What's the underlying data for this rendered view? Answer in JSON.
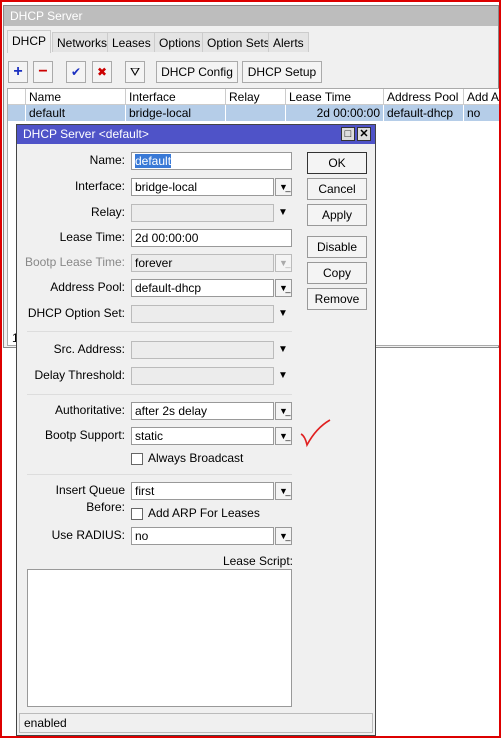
{
  "window": {
    "title": "DHCP Server",
    "tabs": [
      "DHCP",
      "Networks",
      "Leases",
      "Options",
      "Option Sets",
      "Alerts"
    ],
    "toolbar": {
      "add": "+",
      "remove": "−",
      "enable": "✔",
      "disable": "✖",
      "filter": "⛛",
      "dhcp_config": "DHCP Config",
      "dhcp_setup": "DHCP Setup"
    },
    "columns": [
      "Name",
      "Interface",
      "Relay",
      "Lease Time",
      "Address Pool",
      "Add AR"
    ],
    "rows": [
      [
        "default",
        "bridge-local",
        "",
        "2d 00:00:00",
        "default-dhcp",
        "no"
      ]
    ],
    "count_partial": "1"
  },
  "dialog": {
    "title": "DHCP Server <default>",
    "fields": [
      {
        "label": "Name:",
        "value": "default",
        "type": "text"
      },
      {
        "label": "Interface:",
        "value": "bridge-local",
        "type": "combo"
      },
      {
        "label": "Relay:",
        "value": "",
        "type": "opt"
      },
      {
        "label": "Lease Time:",
        "value": "2d 00:00:00",
        "type": "text"
      },
      {
        "label": "Bootp Lease Time:",
        "value": "forever",
        "type": "combo",
        "disabled": true
      },
      {
        "label": "Address Pool:",
        "value": "default-dhcp",
        "type": "combo"
      },
      {
        "label": "DHCP Option Set:",
        "value": "",
        "type": "opt"
      },
      {
        "label": "Src. Address:",
        "value": "",
        "type": "opt"
      },
      {
        "label": "Delay Threshold:",
        "value": "",
        "type": "opt"
      },
      {
        "label": "Authoritative:",
        "value": "after 2s delay",
        "type": "combo"
      },
      {
        "label": "Bootp Support:",
        "value": "static",
        "type": "combo"
      },
      {
        "label": "Always Broadcast",
        "checked": false,
        "type": "check"
      },
      {
        "label": "Insert Queue Before:",
        "value": "first",
        "type": "combo"
      },
      {
        "label": "Add ARP For Leases",
        "checked": false,
        "type": "check"
      },
      {
        "label": "Use RADIUS:",
        "value": "no",
        "type": "combo"
      }
    ],
    "lease_script_label": "Lease Script:",
    "lease_script": "",
    "buttons": [
      "OK",
      "Cancel",
      "Apply",
      "Disable",
      "Copy",
      "Remove"
    ],
    "status": "enabled"
  },
  "colors": {
    "dialog_title": "#4f53c8",
    "selection": "#b5cde8",
    "annotation": "#e02020"
  }
}
